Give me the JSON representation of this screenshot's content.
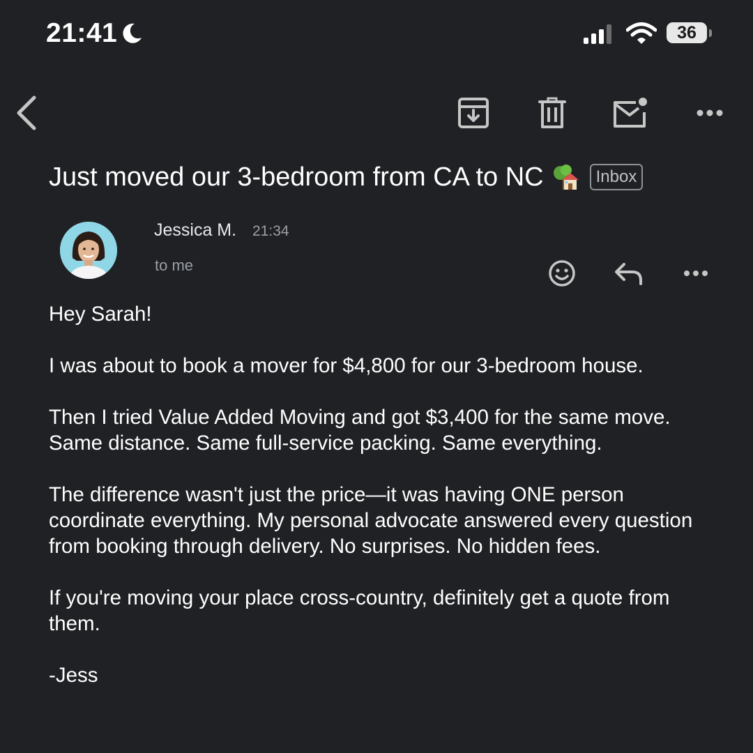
{
  "status_bar": {
    "time": "21:41",
    "battery_level": "36",
    "icons": [
      "moon-icon",
      "signal-icon",
      "wifi-icon",
      "battery-icon"
    ]
  },
  "toolbar": {
    "icons": [
      "back-arrow-icon",
      "archive-icon",
      "trash-icon",
      "mark-unread-icon",
      "more-options-icon"
    ]
  },
  "email": {
    "subject": "Just moved our 3-bedroom from CA to NC",
    "subject_emoji": "house-with-garden",
    "label": "Inbox",
    "sender_name": "Jessica M.",
    "time": "21:34",
    "recipient": "to me",
    "body": {
      "greeting": "Hey Sarah!",
      "p1": "I was about to book a mover for $4,800 for our 3-bedroom house.",
      "p2": "Then I tried Value Added Moving and got $3,400 for the same move. Same distance. Same full-service packing. Same everything.",
      "p3": "The difference wasn't just the price—it was having ONE person coordinate everything. My personal advocate answered every question from booking through delivery. No surprises. No hidden fees.",
      "p4": "If you're moving your place cross-country, definitely get a quote from them.",
      "signature": "-Jess"
    }
  },
  "message_actions": {
    "icons": [
      "emoji-reaction-icon",
      "reply-icon",
      "more-options-icon"
    ]
  },
  "colors": {
    "background": "#202124",
    "text_primary": "#ffffff",
    "text_secondary": "#9aa0a6",
    "icon": "#c4c7c5",
    "avatar_bg": "#8fd6e6"
  }
}
